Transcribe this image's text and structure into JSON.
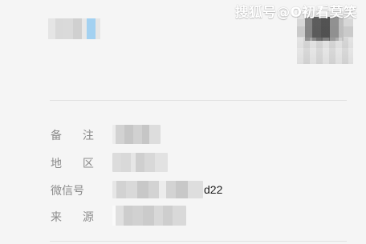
{
  "watermark": {
    "text": "搜狐号@O初看莫笑"
  },
  "info": {
    "rows": [
      {
        "label": "备 注",
        "value_suffix": ""
      },
      {
        "label": "地 区",
        "value_suffix": ""
      },
      {
        "label": "微信号",
        "value_suffix": "d22"
      },
      {
        "label": "来 源",
        "value_suffix": ""
      }
    ]
  }
}
